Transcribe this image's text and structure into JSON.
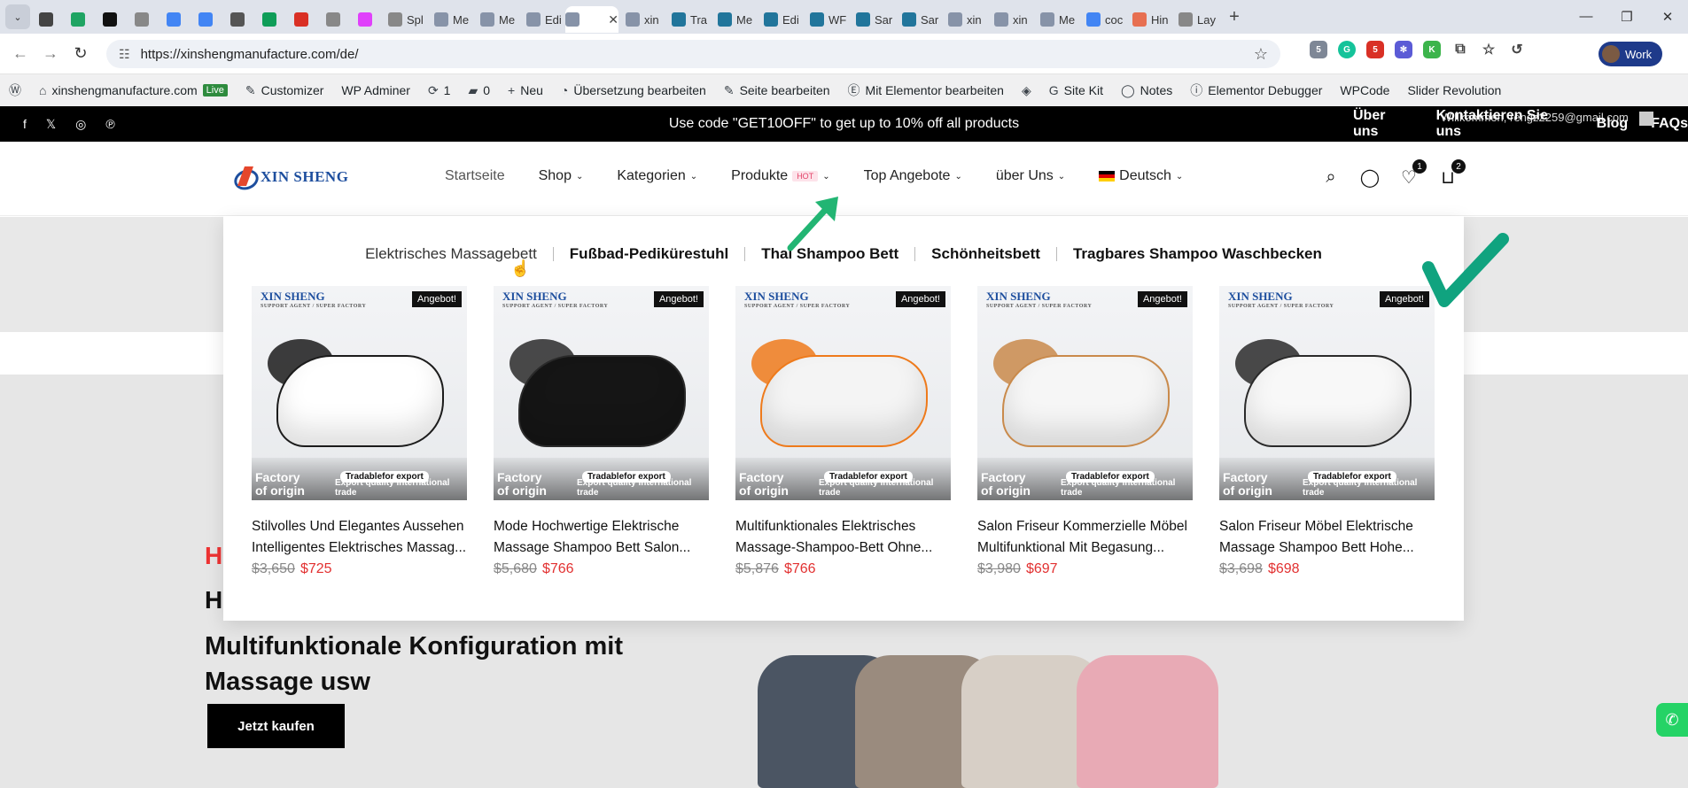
{
  "browser": {
    "tabs": [
      {
        "label": "",
        "icon": "chrome-icon",
        "color": "#444"
      },
      {
        "label": "",
        "icon": "drive-icon",
        "color": "#1fa463"
      },
      {
        "label": "",
        "icon": "a-icon",
        "color": "#111"
      },
      {
        "label": "",
        "icon": "loading-icon",
        "color": "#888"
      },
      {
        "label": "",
        "icon": "calendar-icon",
        "color": "#4285f4"
      },
      {
        "label": "",
        "icon": "translate-icon",
        "color": "#4285f4"
      },
      {
        "label": "",
        "icon": "gear-icon",
        "color": "#555"
      },
      {
        "label": "",
        "icon": "sheets-icon",
        "color": "#0f9d58"
      },
      {
        "label": "",
        "icon": "gmail-icon",
        "color": "#d93025"
      },
      {
        "label": "",
        "icon": "loading-icon",
        "color": "#888"
      },
      {
        "label": "",
        "icon": "spark-icon",
        "color": "#e040fb"
      },
      {
        "label": "Spl",
        "icon": "loading-icon",
        "color": "#888"
      },
      {
        "label": "Me",
        "icon": "elementor-icon",
        "color": "#8793a8"
      },
      {
        "label": "Me",
        "icon": "elementor-icon",
        "color": "#8793a8"
      },
      {
        "label": "Edi",
        "icon": "elementor-icon",
        "color": "#8793a8"
      },
      {
        "label": "",
        "icon": "elementor-icon",
        "color": "#8793a8",
        "active": true
      },
      {
        "label": "xin",
        "icon": "elementor-icon",
        "color": "#8793a8"
      },
      {
        "label": "Tra",
        "icon": "wordpress-icon",
        "color": "#21759b"
      },
      {
        "label": "Me",
        "icon": "wordpress-icon",
        "color": "#21759b"
      },
      {
        "label": "Edi",
        "icon": "wordpress-icon",
        "color": "#21759b"
      },
      {
        "label": "WF",
        "icon": "wordpress-icon",
        "color": "#21759b"
      },
      {
        "label": "Sar",
        "icon": "wordpress-icon",
        "color": "#21759b"
      },
      {
        "label": "Sar",
        "icon": "wordpress-icon",
        "color": "#21759b"
      },
      {
        "label": "xin",
        "icon": "elementor-icon",
        "color": "#8793a8"
      },
      {
        "label": "xin",
        "icon": "elementor-icon",
        "color": "#8793a8"
      },
      {
        "label": "Me",
        "icon": "elementor-icon",
        "color": "#8793a8"
      },
      {
        "label": "coc",
        "icon": "google-icon",
        "color": "#4285f4"
      },
      {
        "label": "Hin",
        "icon": "flame-icon",
        "color": "#e76f51"
      },
      {
        "label": "Lay",
        "icon": "loading-icon",
        "color": "#888"
      }
    ],
    "url": "https://xinshengmanufacture.com/de/",
    "profile_label": "Work"
  },
  "wpbar": {
    "site": "xinshengmanufacture.com",
    "live": "Live",
    "customizer": "Customizer",
    "wp_adminer": "WP Adminer",
    "updates": "1",
    "comments": "0",
    "new": "Neu",
    "translate": "Übersetzung bearbeiten",
    "edit_page": "Seite bearbeiten",
    "elementor": "Mit Elementor bearbeiten",
    "site_kit": "Site Kit",
    "notes": "Notes",
    "debugger": "Elementor Debugger",
    "wpcode": "WPCode",
    "slider": "Slider Revolution"
  },
  "promo": {
    "text": "Use code \"GET10OFF\" to get up to 10% off all products",
    "links": [
      "Über uns",
      "Kontaktieren Sie uns",
      "Blog",
      "FAQs"
    ],
    "welcome": "Willkommen, rengz2259@gmail.com"
  },
  "header": {
    "logo": "XIN SHENG",
    "nav": {
      "home": "Startseite",
      "shop": "Shop",
      "categories": "Kategorien",
      "products": "Produkte",
      "hot": "HOT",
      "offers": "Top Angebote",
      "about": "über Uns",
      "language": "Deutsch"
    },
    "wishlist_count": "1",
    "cart_count": "2"
  },
  "mega": {
    "subcats": [
      "Elektrisches Massagebett",
      "Fußbad-Pediküre­stuhl",
      "Thai Shampoo Bett",
      "Schönheitsbett",
      "Tragbares Shampoo Waschbecken"
    ],
    "products": [
      {
        "title1": "Stilvolles Und Elegantes Aussehen",
        "title2": "Intelligentes Elektrisches Massag...",
        "old": "$3,650",
        "new": "$725",
        "sale": "Angebot!",
        "body": "#ffffff",
        "seat": "#1b1b1b"
      },
      {
        "title1": "Mode Hochwertige Elektrische",
        "title2": "Massage Shampoo Bett Salon...",
        "old": "$5,680",
        "new": "$766",
        "sale": "Angebot!",
        "body": "#151515",
        "seat": "#2a2a2a"
      },
      {
        "title1": "Multifunktionales Elektrisches",
        "title2": "Massage-Shampoo-Bett Ohne...",
        "old": "$5,876",
        "new": "$766",
        "sale": "Angebot!",
        "body": "#f4f4f4",
        "seat": "#ee7a1b"
      },
      {
        "title1": "Salon Friseur Kommerzielle Möbel",
        "title2": "Multifunktional Mit Begasung...",
        "old": "$3,980",
        "new": "$697",
        "sale": "Angebot!",
        "body": "#f6f6f6",
        "seat": "#c98a4b"
      },
      {
        "title1": "Salon Friseur Möbel Elektrische",
        "title2": "Massage Shampoo Bett Hohe...",
        "old": "$3,698",
        "new": "$698",
        "sale": "Angebot!",
        "body": "#f8f8f8",
        "seat": "#2a2a2a"
      }
    ],
    "badge_brand": "XIN SHENG",
    "badge_brand_sub": "SUPPORT AGENT / SUPER FACTORY",
    "factory_line1": "Factory",
    "factory_line2": "of origin",
    "trade": "Tradablefor export",
    "quality": "Export quality international trade"
  },
  "hero": {
    "red": "H",
    "h1": "H",
    "sub": "Multifunktionale Konfiguration mit Massage usw",
    "button": "Jetzt kaufen"
  },
  "annotation_color": "#22b573",
  "checkmark_color": "#10a37f"
}
